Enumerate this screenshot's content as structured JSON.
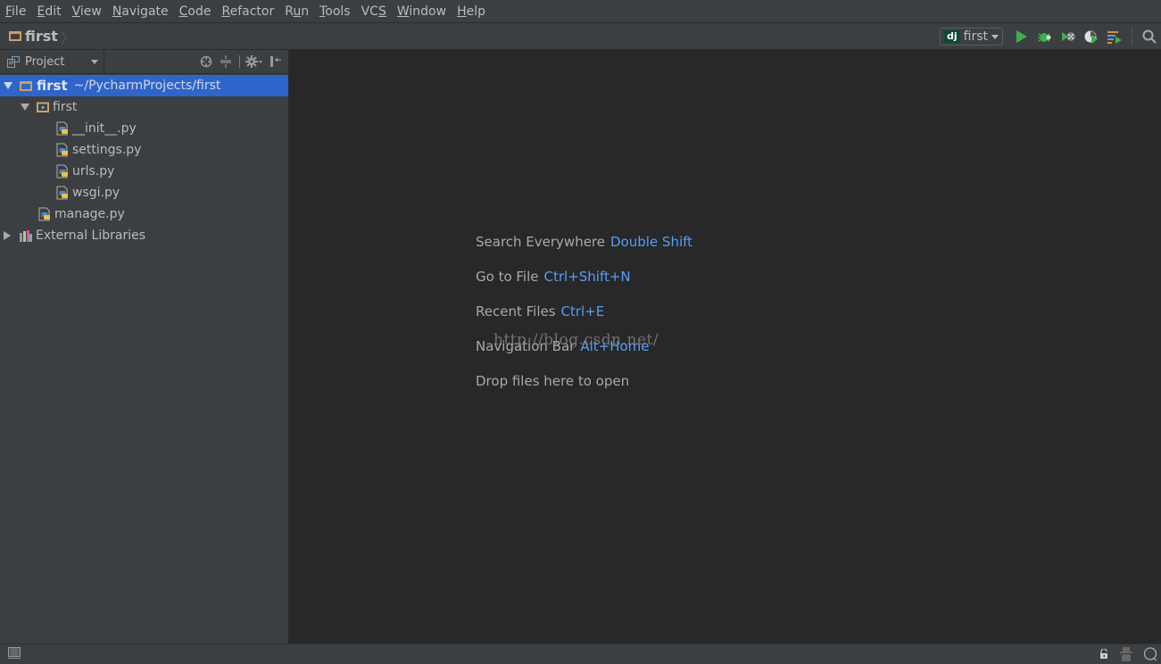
{
  "menubar": {
    "items": [
      {
        "label": "File",
        "mnemonic": "F",
        "rest": "ile"
      },
      {
        "label": "Edit",
        "mnemonic": "E",
        "rest": "dit"
      },
      {
        "label": "View",
        "mnemonic": "V",
        "rest": "iew"
      },
      {
        "label": "Navigate",
        "mnemonic": "N",
        "rest": "avigate"
      },
      {
        "label": "Code",
        "mnemonic": "C",
        "rest": "ode"
      },
      {
        "label": "Refactor",
        "mnemonic": "R",
        "rest": "efactor"
      },
      {
        "label": "Run",
        "pre": "R",
        "mnemonic": "u",
        "rest": "n"
      },
      {
        "label": "Tools",
        "mnemonic": "T",
        "rest": "ools"
      },
      {
        "label": "VCS",
        "pre": "VC",
        "mnemonic": "S",
        "rest": ""
      },
      {
        "label": "Window",
        "mnemonic": "W",
        "rest": "indow"
      },
      {
        "label": "Help",
        "mnemonic": "H",
        "rest": "elp"
      }
    ]
  },
  "navbar": {
    "breadcrumb": "first",
    "run_config": {
      "badge": "dj",
      "label": "first"
    },
    "icons": [
      "run-icon",
      "debug-icon",
      "coverage-icon",
      "profile-icon",
      "concurrency-icon",
      "search-icon"
    ],
    "colors": {
      "run": "#3fae4f",
      "debug": "#3fae4f"
    }
  },
  "project_panel": {
    "title": "Project",
    "actions": [
      "scroll-from-source-icon",
      "collapse-all-icon",
      "settings-icon",
      "hide-icon"
    ],
    "tree": [
      {
        "label": "first",
        "path": "~/PycharmProjects/first",
        "type": "project-root",
        "expanded": true,
        "selected": true,
        "depth": 0
      },
      {
        "label": "first",
        "type": "package",
        "expanded": true,
        "depth": 1
      },
      {
        "label": "__init__.py",
        "type": "python-file",
        "depth": 2
      },
      {
        "label": "settings.py",
        "type": "python-file",
        "depth": 2
      },
      {
        "label": "urls.py",
        "type": "python-file",
        "depth": 2
      },
      {
        "label": "wsgi.py",
        "type": "python-file",
        "depth": 2
      },
      {
        "label": "manage.py",
        "type": "python-file",
        "depth": 1
      },
      {
        "label": "External Libraries",
        "type": "libraries",
        "expanded": false,
        "depth": 0
      }
    ]
  },
  "editor": {
    "hints": [
      {
        "text": "Search Everywhere",
        "key": "Double Shift"
      },
      {
        "text": "Go to File",
        "key": "Ctrl+Shift+N"
      },
      {
        "text": "Recent Files",
        "key": "Ctrl+E"
      },
      {
        "text": "Navigation Bar",
        "key": "Alt+Home"
      },
      {
        "text": "Drop files here to open",
        "key": ""
      }
    ],
    "watermark": "http://blog.csdn.net/",
    "accent_color": "#589df6"
  },
  "statusbar": {
    "icons": [
      "tool-windows-icon",
      "lock-icon",
      "inspector-icon",
      "event-log-icon"
    ]
  }
}
